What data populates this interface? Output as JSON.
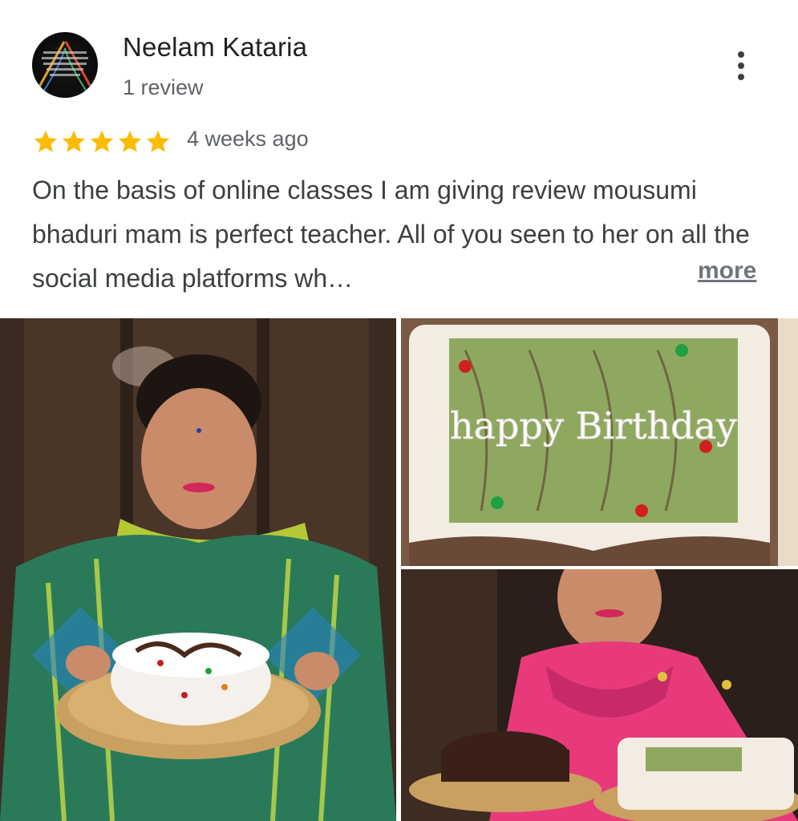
{
  "review": {
    "author": "Neelam Kataria",
    "review_count": "1 review",
    "rating": 5,
    "time_ago": "4 weeks ago",
    "text": "On the basis of online classes I am giving review mousumi bhaduri mam is perfect teacher. All of you seen to her on all the social media platforms wh…",
    "more_label": "more"
  },
  "photos": {
    "cake_writing": "happy Birthday"
  },
  "colors": {
    "star": "#fbbc04",
    "text": "#3c4043",
    "secondary": "#5f6368"
  },
  "icons": {
    "menu": "more-vertical-icon",
    "star": "star-icon"
  }
}
